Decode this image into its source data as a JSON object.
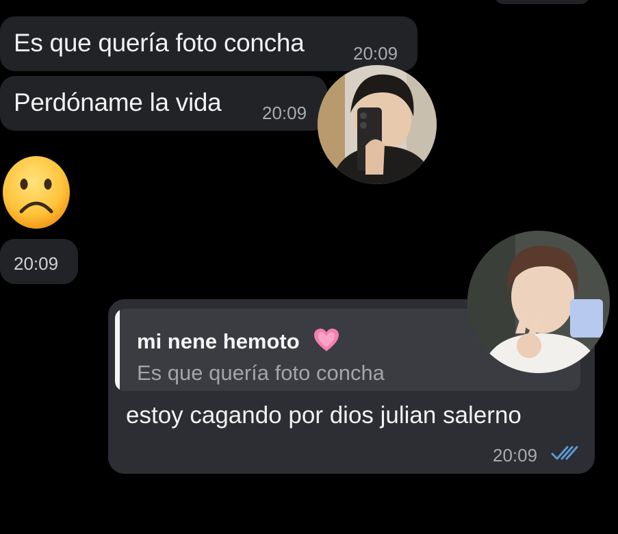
{
  "messages": {
    "incoming": [
      {
        "text": "Es que quería foto concha",
        "time": "20:09"
      },
      {
        "text": "Perdóname la vida",
        "time": "20:09"
      },
      {
        "emoji": "frowning-face-icon",
        "time": "20:09"
      }
    ],
    "outgoing": {
      "reply_to": {
        "name": "mi nene hemoto",
        "name_emoji": "pink-heart-icon",
        "text": "Es que quería foto concha"
      },
      "text": "estoy cagando por dios julian salerno",
      "time": "20:09",
      "status": "read-double-check-icon"
    }
  },
  "colors": {
    "background": "#000000",
    "incoming_bubble": "#212327",
    "outgoing_bubble": "#2c2e33",
    "read_ticks": "#5b9bd5",
    "heart": "#f47fb0"
  }
}
